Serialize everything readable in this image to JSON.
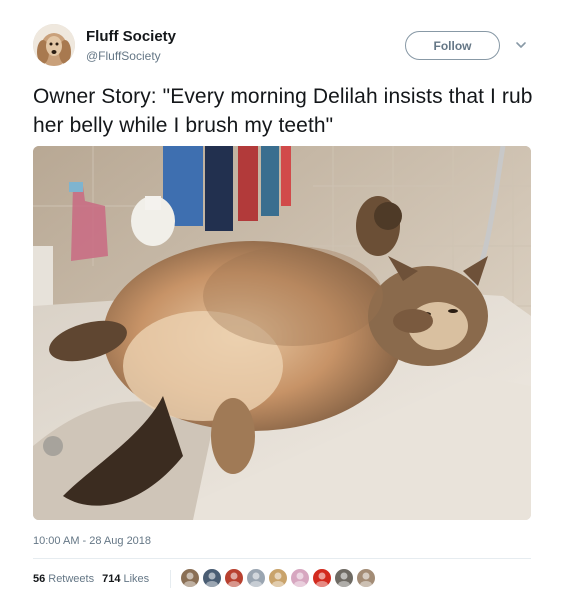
{
  "author": {
    "display_name": "Fluff Society",
    "handle": "@FluffSociety",
    "avatar_icon": "dog-avatar-icon"
  },
  "follow_label": "Follow",
  "tweet_text": "Owner Story: \"Every morning Delilah insists that I rub her belly while I brush my teeth\"",
  "timestamp": "10:00 AM - 28 Aug 2018",
  "stats": {
    "retweets_count": "56",
    "retweets_label": "Retweets",
    "likes_count": "714",
    "likes_label": "Likes"
  },
  "likers": [
    {
      "icon": "dog-avatar-icon",
      "color": "#8a6f55"
    },
    {
      "icon": "building-avatar-icon",
      "color": "#4a5d73"
    },
    {
      "icon": "red-avatar-icon",
      "color": "#b8402f"
    },
    {
      "icon": "default-avatar-icon",
      "color": "#9aa5b1"
    },
    {
      "icon": "bird-avatar-icon",
      "color": "#c9a36b"
    },
    {
      "icon": "flower-avatar-icon",
      "color": "#d7a7c0"
    },
    {
      "icon": "red-star-avatar-icon",
      "color": "#d22a1e"
    },
    {
      "icon": "cat-avatar-icon",
      "color": "#6e6a63"
    },
    {
      "icon": "animal-avatar-icon",
      "color": "#a38c76"
    }
  ],
  "colors": {
    "text_primary": "#14171a",
    "text_secondary": "#657786",
    "divider": "#e6ecf0"
  }
}
